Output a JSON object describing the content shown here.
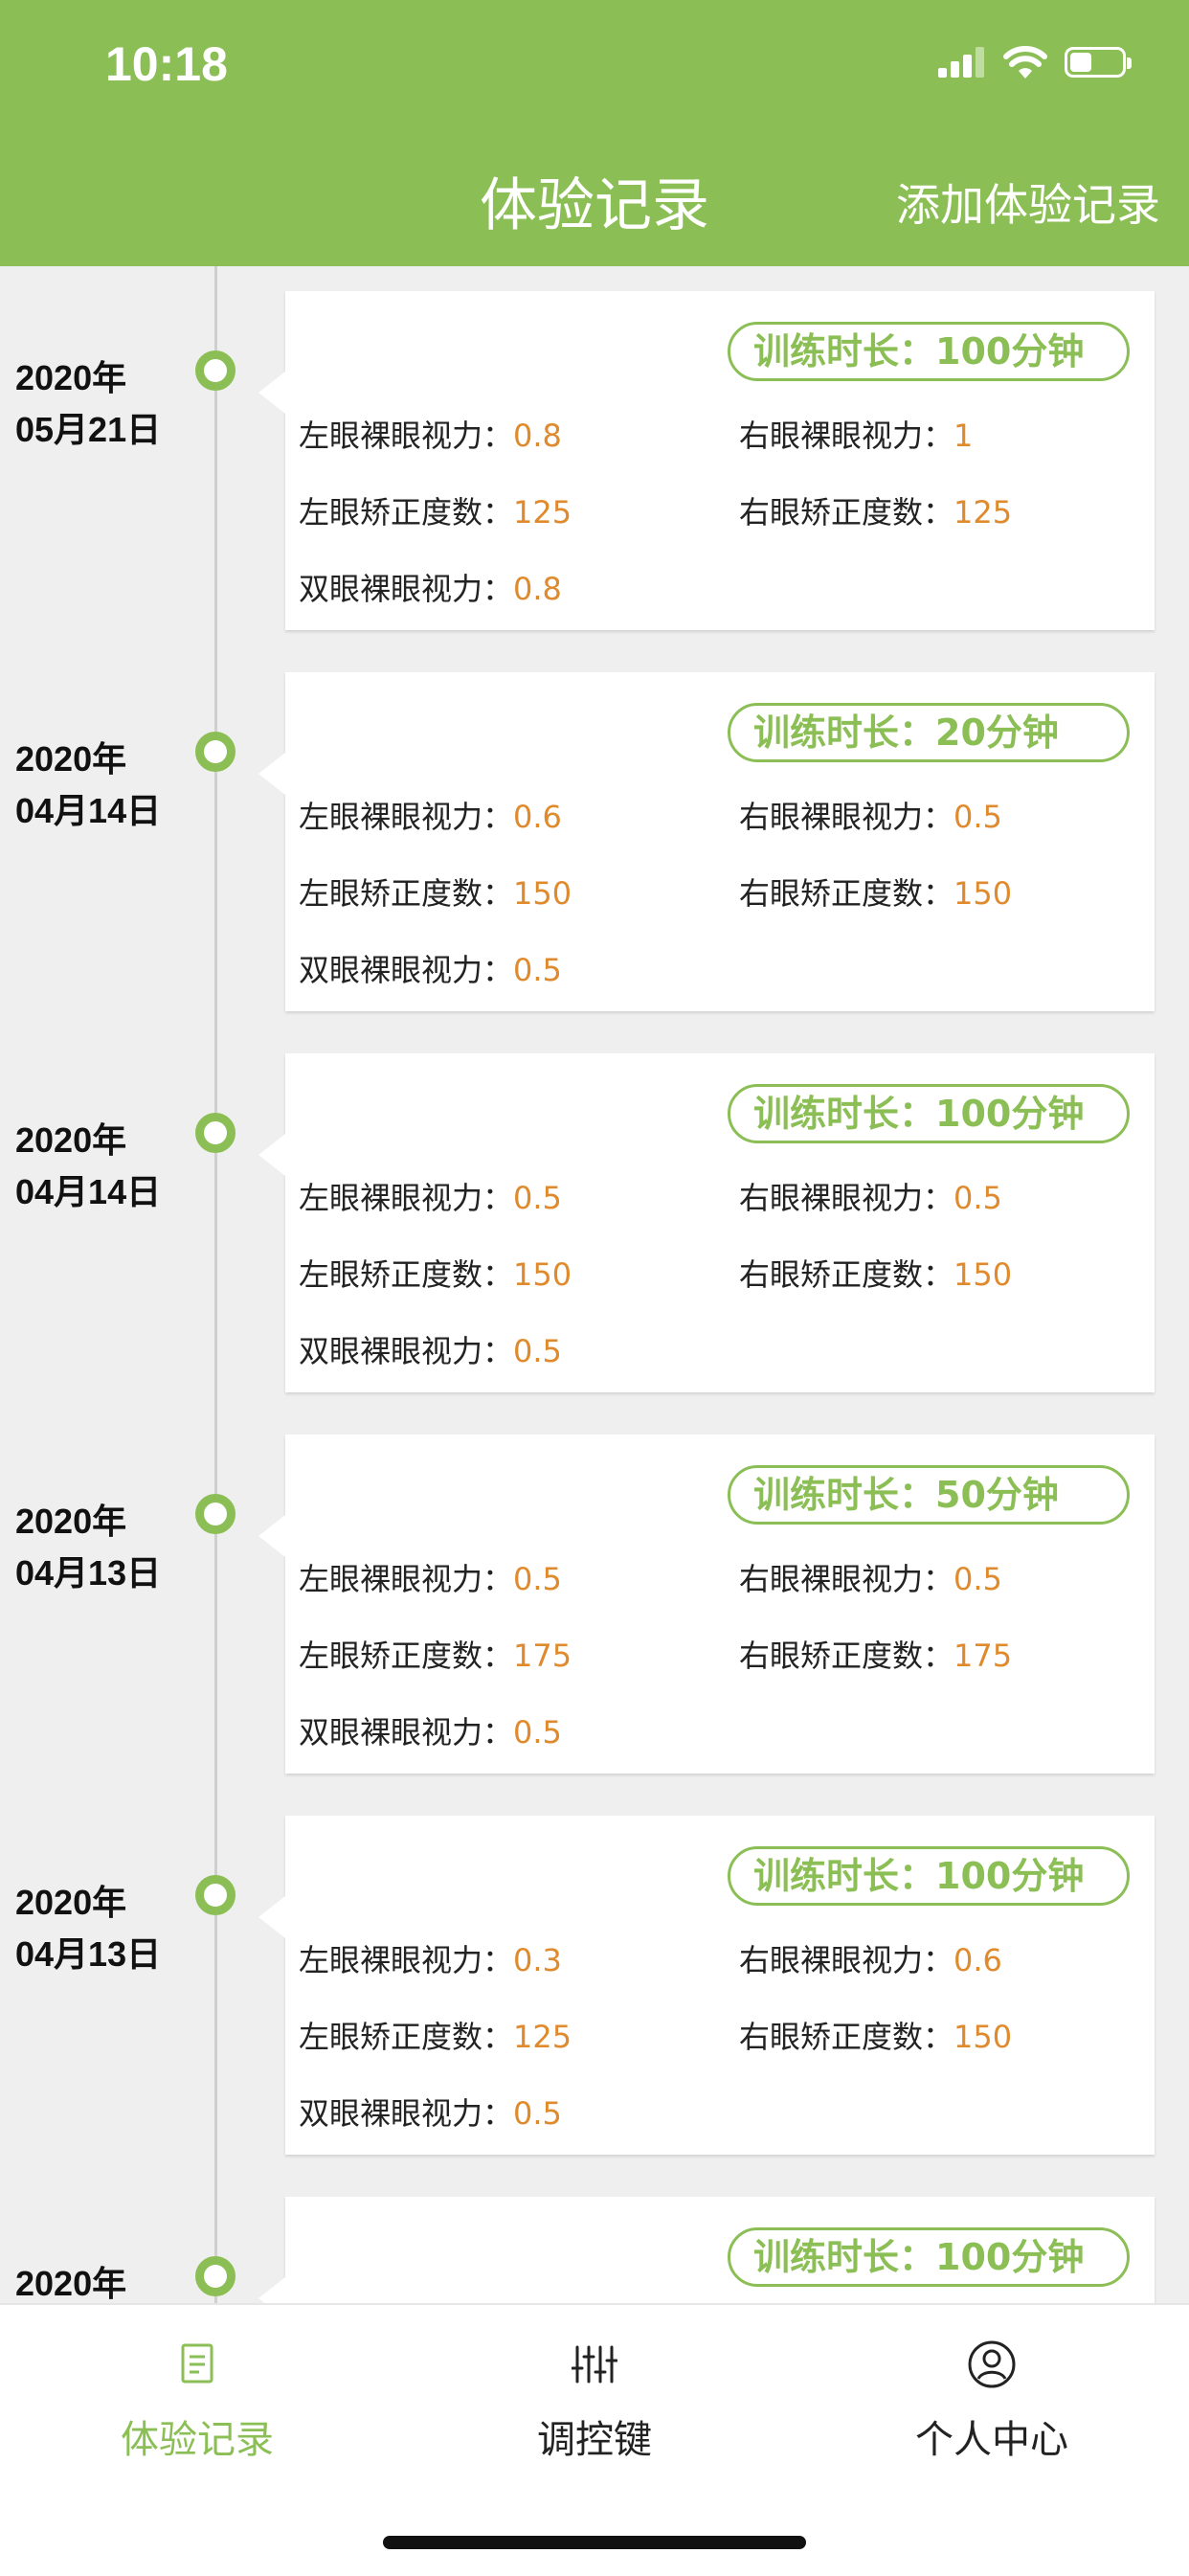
{
  "status_bar": {
    "time": "10:18"
  },
  "header": {
    "title": "体验记录",
    "add_button": "添加体验记录"
  },
  "labels": {
    "left_naked": "左眼裸眼视力：",
    "right_naked": "右眼裸眼视力：",
    "left_correction": "左眼矫正度数：",
    "right_correction": "右眼矫正度数：",
    "both_naked": "双眼裸眼视力："
  },
  "records": [
    {
      "year": "2020年",
      "day": "05月21日",
      "duration": "训练时长：100分钟",
      "left_naked": "0.8",
      "right_naked": "1",
      "left_correction": "125",
      "right_correction": "125",
      "both_naked": "0.8"
    },
    {
      "year": "2020年",
      "day": "04月14日",
      "duration": "训练时长：20分钟",
      "left_naked": "0.6",
      "right_naked": "0.5",
      "left_correction": "150",
      "right_correction": "150",
      "both_naked": "0.5"
    },
    {
      "year": "2020年",
      "day": "04月14日",
      "duration": "训练时长：100分钟",
      "left_naked": "0.5",
      "right_naked": "0.5",
      "left_correction": "150",
      "right_correction": "150",
      "both_naked": "0.5"
    },
    {
      "year": "2020年",
      "day": "04月13日",
      "duration": "训练时长：50分钟",
      "left_naked": "0.5",
      "right_naked": "0.5",
      "left_correction": "175",
      "right_correction": "175",
      "both_naked": "0.5"
    },
    {
      "year": "2020年",
      "day": "04月13日",
      "duration": "训练时长：100分钟",
      "left_naked": "0.3",
      "right_naked": "0.6",
      "left_correction": "125",
      "right_correction": "150",
      "both_naked": "0.5"
    },
    {
      "year": "2020年",
      "duration": "训练时长：100分钟"
    }
  ],
  "tabs": [
    {
      "label": "体验记录",
      "icon": "document-icon",
      "active": true
    },
    {
      "label": "调控键",
      "icon": "sliders-icon",
      "active": false
    },
    {
      "label": "个人中心",
      "icon": "user-icon",
      "active": false
    }
  ],
  "colors": {
    "accent": "#8bbf55",
    "value": "#e08a2e",
    "background": "#efefef"
  }
}
